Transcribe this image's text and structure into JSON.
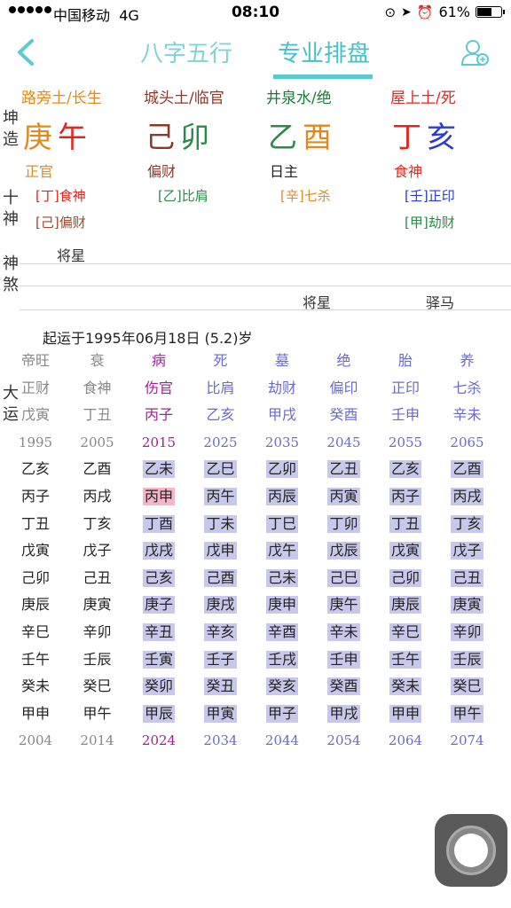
{
  "status_bar": {
    "carrier": "中国移动",
    "network": "4G",
    "time": "08:10",
    "battery": "61%"
  },
  "nav": {
    "tabs": [
      "八字五行",
      "专业排盘"
    ],
    "active_tab": 1
  },
  "side_labels": {
    "gender": [
      "坤",
      "造"
    ],
    "shishen": [
      "十",
      "神"
    ],
    "shensha": [
      "神",
      "煞"
    ],
    "dayun": [
      "大",
      "运"
    ]
  },
  "pillars": [
    {
      "nayin": "路旁土/长生",
      "nayin_color": "#e08a1e",
      "stem": "庚",
      "stem_color": "#e08a1e",
      "branch": "午",
      "branch_color": "#e0261e",
      "shishen": "正官",
      "shishen_color": "#e08a1e",
      "cang": [
        {
          "text": "[丁]食神",
          "color": "#e0261e"
        },
        {
          "text": "[己]偏财",
          "color": "#9b4a2a"
        }
      ]
    },
    {
      "nayin": "城头土/临官",
      "nayin_color": "#8b3a2a",
      "stem": "己",
      "stem_color": "#8b3a2a",
      "branch": "卯",
      "branch_color": "#2a8a4a",
      "shishen": "偏财",
      "shishen_color": "#8b3a2a",
      "cang": [
        {
          "text": "[乙]比肩",
          "color": "#2a8a4a"
        }
      ]
    },
    {
      "nayin": "井泉水/绝",
      "nayin_color": "#1a7a3a",
      "stem": "乙",
      "stem_color": "#2a8a4a",
      "branch": "酉",
      "branch_color": "#e08a1e",
      "shishen": "日主",
      "shishen_color": "#222222",
      "cang": [
        {
          "text": "[辛]七杀",
          "color": "#e08a1e"
        }
      ]
    },
    {
      "nayin": "屋上土/死",
      "nayin_color": "#e0261e",
      "stem": "丁",
      "stem_color": "#e0261e",
      "branch": "亥",
      "branch_color": "#2a3ad8",
      "shishen": "食神",
      "shishen_color": "#e0261e",
      "cang": [
        {
          "text": "[壬]正印",
          "color": "#2a3ad8"
        },
        {
          "text": "[甲]劫财",
          "color": "#2a8a4a"
        }
      ]
    }
  ],
  "shensha": {
    "row1": [
      "将星"
    ],
    "row2": [
      "将星",
      "驿马"
    ]
  },
  "qiyun": "起运于1995年06月18日 (5.2)岁",
  "dayun": [
    {
      "state": "帝旺",
      "shishen": "正财",
      "gz": "戊寅",
      "year": "1995",
      "color": "#888888",
      "liunian": [
        "乙亥",
        "丙子",
        "丁丑",
        "戊寅",
        "己卯",
        "庚辰",
        "辛巳",
        "壬午",
        "癸未",
        "甲申"
      ],
      "end": "2004",
      "hl": false
    },
    {
      "state": "衰",
      "shishen": "食神",
      "gz": "丁丑",
      "year": "2005",
      "color": "#888888",
      "liunian": [
        "乙酉",
        "丙戌",
        "丁亥",
        "戊子",
        "己丑",
        "庚寅",
        "辛卯",
        "壬辰",
        "癸巳",
        "甲午"
      ],
      "end": "2014",
      "hl": false
    },
    {
      "state": "病",
      "shishen": "伤官",
      "gz": "丙子",
      "year": "2015",
      "color": "#a0229a",
      "liunian": [
        "乙未",
        "丙申",
        "丁酉",
        "戊戌",
        "己亥",
        "庚子",
        "辛丑",
        "壬寅",
        "癸卯",
        "甲辰"
      ],
      "end": "2024",
      "hl": true
    },
    {
      "state": "死",
      "shishen": "比肩",
      "gz": "乙亥",
      "year": "2025",
      "color": "#6a6ad0",
      "liunian": [
        "乙巳",
        "丙午",
        "丁未",
        "戊申",
        "己酉",
        "庚戌",
        "辛亥",
        "壬子",
        "癸丑",
        "甲寅"
      ],
      "end": "2034",
      "hl": true
    },
    {
      "state": "墓",
      "shishen": "劫财",
      "gz": "甲戌",
      "year": "2035",
      "color": "#6a6ad0",
      "liunian": [
        "乙卯",
        "丙辰",
        "丁巳",
        "戊午",
        "己未",
        "庚申",
        "辛酉",
        "壬戌",
        "癸亥",
        "甲子"
      ],
      "end": "2044",
      "hl": true
    },
    {
      "state": "绝",
      "shishen": "偏印",
      "gz": "癸酉",
      "year": "2045",
      "color": "#6a6ad0",
      "liunian": [
        "乙丑",
        "丙寅",
        "丁卯",
        "戊辰",
        "己巳",
        "庚午",
        "辛未",
        "壬申",
        "癸酉",
        "甲戌"
      ],
      "end": "2054",
      "hl": true
    },
    {
      "state": "胎",
      "shishen": "正印",
      "gz": "壬申",
      "year": "2055",
      "color": "#6a6ad0",
      "liunian": [
        "乙亥",
        "丙子",
        "丁丑",
        "戊寅",
        "己卯",
        "庚辰",
        "辛巳",
        "壬午",
        "癸未",
        "甲申"
      ],
      "end": "2064",
      "hl": true
    },
    {
      "state": "养",
      "shishen": "七杀",
      "gz": "辛未",
      "year": "2065",
      "color": "#6a6ad0",
      "liunian": [
        "乙酉",
        "丙戌",
        "丁亥",
        "戊子",
        "己丑",
        "庚寅",
        "辛卯",
        "壬辰",
        "癸巳",
        "甲午"
      ],
      "end": "2074",
      "hl": true
    }
  ],
  "current_liunian": {
    "col": 2,
    "row": 1
  },
  "accent_color": "#5ccad1"
}
